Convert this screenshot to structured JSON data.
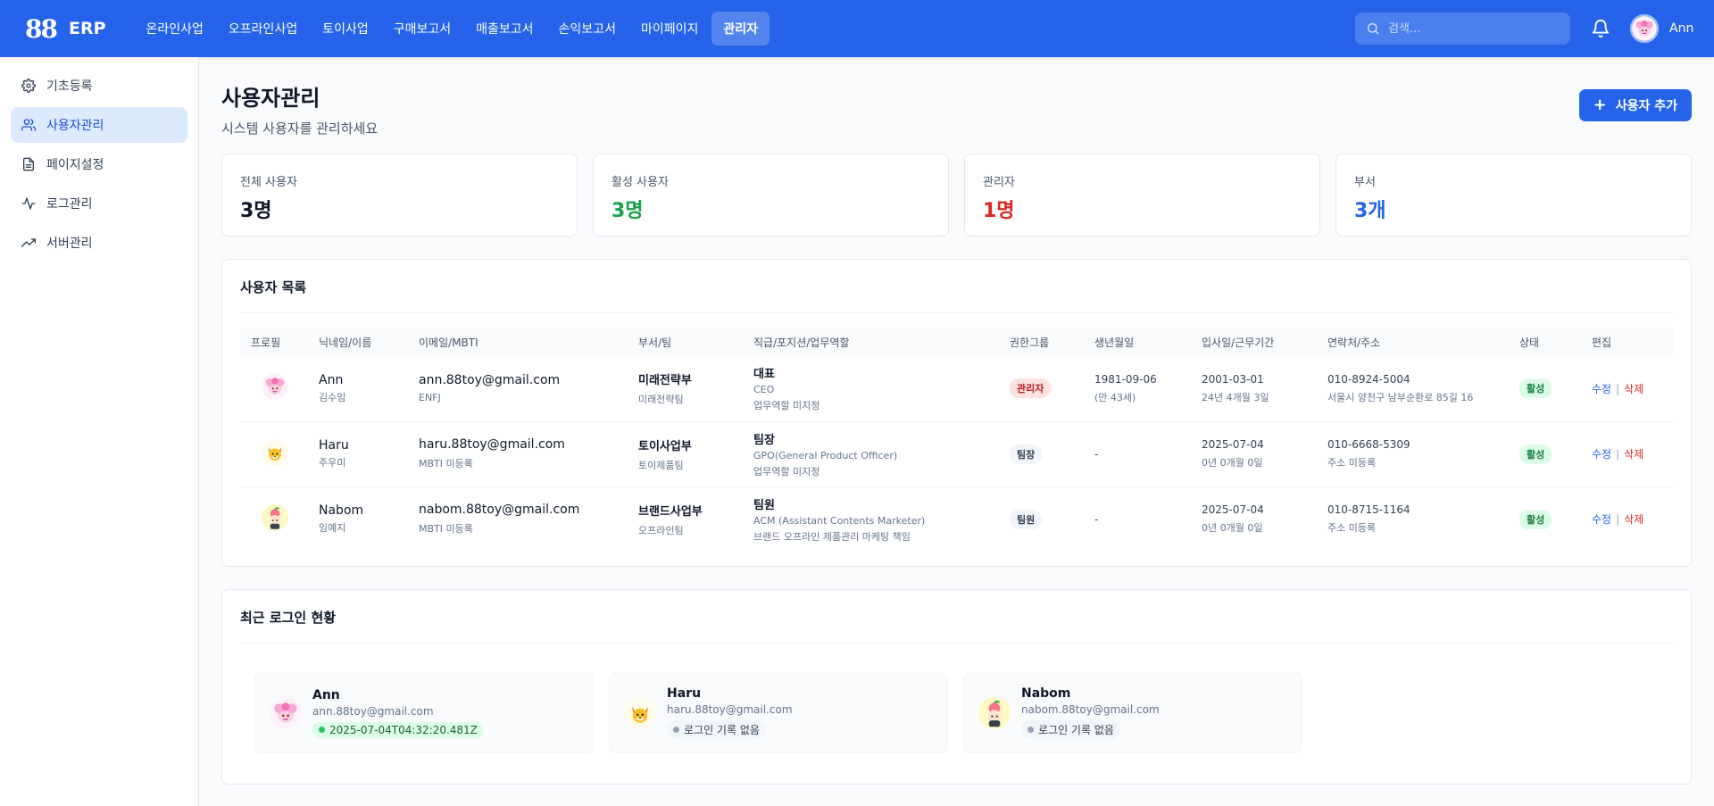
{
  "header": {
    "logo": "88",
    "app_name": "ERP",
    "nav": [
      {
        "label": "온라인사업"
      },
      {
        "label": "오프라인사업"
      },
      {
        "label": "토이사업"
      },
      {
        "label": "구매보고서"
      },
      {
        "label": "매출보고서"
      },
      {
        "label": "손익보고서"
      },
      {
        "label": "마이페이지"
      },
      {
        "label": "관리자",
        "active": true
      }
    ],
    "search_placeholder": "검색...",
    "user_name": "Ann",
    "accent_color": "#2563eb"
  },
  "sidebar": {
    "items": [
      {
        "label": "기초등록",
        "icon": "gear-icon"
      },
      {
        "label": "사용자관리",
        "icon": "users-icon",
        "active": true
      },
      {
        "label": "페이지설정",
        "icon": "document-icon"
      },
      {
        "label": "로그관리",
        "icon": "activity-icon"
      },
      {
        "label": "서버관리",
        "icon": "trending-up-icon"
      }
    ]
  },
  "page": {
    "title": "사용자관리",
    "subtitle": "시스템 사용자를 관리하세요",
    "add_button": "사용자 추가"
  },
  "stats": [
    {
      "label": "전체 사용자",
      "value": "3명",
      "color": "#0f172a"
    },
    {
      "label": "활성 사용자",
      "value": "3명",
      "color": "#16a34a"
    },
    {
      "label": "관리자",
      "value": "1명",
      "color": "#dc2626"
    },
    {
      "label": "부서",
      "value": "3개",
      "color": "#2563eb"
    }
  ],
  "user_table": {
    "title": "사용자 목록",
    "columns": [
      "프로필",
      "닉네임/이름",
      "이메일/MBTI",
      "부서/팀",
      "직급/포지션/업무역할",
      "권한그룹",
      "생년월일",
      "입사일/근무기간",
      "연락처/주소",
      "상태",
      "편집"
    ],
    "rows": [
      {
        "nickname": "Ann",
        "name": "김수임",
        "email": "ann.88toy@gmail.com",
        "mbti": "ENFJ",
        "dept": "미래전략부",
        "team": "미래전략팀",
        "rank": "대표",
        "position": "CEO",
        "role": "업무역할 미지정",
        "group": "관리자",
        "group_style": "admin",
        "birth": "1981-09-06",
        "age": "(만 43세)",
        "join": "2001-03-01",
        "tenure": "24년 4개월 3일",
        "phone": "010-8924-5004",
        "address": "서울시 양천구 남부순환로 85길 16",
        "status": "활성",
        "edit": "수정",
        "delete": "삭제",
        "avatar": "pink"
      },
      {
        "nickname": "Haru",
        "name": "주우미",
        "email": "haru.88toy@gmail.com",
        "mbti": "MBTI 미등록",
        "dept": "토이사업부",
        "team": "토이제품팀",
        "rank": "팀장",
        "position": "GPO(General Product Officer)",
        "role": "업무역할 미지정",
        "group": "팀장",
        "group_style": "gray",
        "birth": "-",
        "age": "",
        "join": "2025-07-04",
        "tenure": "0년 0개월 0일",
        "phone": "010-6668-5309",
        "address": "주소 미등록",
        "status": "활성",
        "edit": "수정",
        "delete": "삭제",
        "avatar": "fox"
      },
      {
        "nickname": "Nabom",
        "name": "임예지",
        "email": "nabom.88toy@gmail.com",
        "mbti": "MBTI 미등록",
        "dept": "브랜드사업부",
        "team": "오프라인팀",
        "rank": "팀원",
        "position": "ACM (Assistant Contents Marketer)",
        "role": "브랜드 오프라인 제품관리 마케팅 책임",
        "group": "팀원",
        "group_style": "gray",
        "birth": "-",
        "age": "",
        "join": "2025-07-04",
        "tenure": "0년 0개월 0일",
        "phone": "010-8715-1164",
        "address": "주소 미등록",
        "status": "활성",
        "edit": "수정",
        "delete": "삭제",
        "avatar": "peach"
      }
    ]
  },
  "recent_logins": {
    "title": "최근 로그인 현황",
    "items": [
      {
        "name": "Ann",
        "email": "ann.88toy@gmail.com",
        "last_login": "2025-07-04T04:32:20.481Z",
        "has_login": true,
        "avatar": "pink"
      },
      {
        "name": "Haru",
        "email": "haru.88toy@gmail.com",
        "last_login": "로그인 기록 없음",
        "has_login": false,
        "avatar": "fox"
      },
      {
        "name": "Nabom",
        "email": "nabom.88toy@gmail.com",
        "last_login": "로그인 기록 없음",
        "has_login": false,
        "avatar": "peach"
      }
    ]
  }
}
